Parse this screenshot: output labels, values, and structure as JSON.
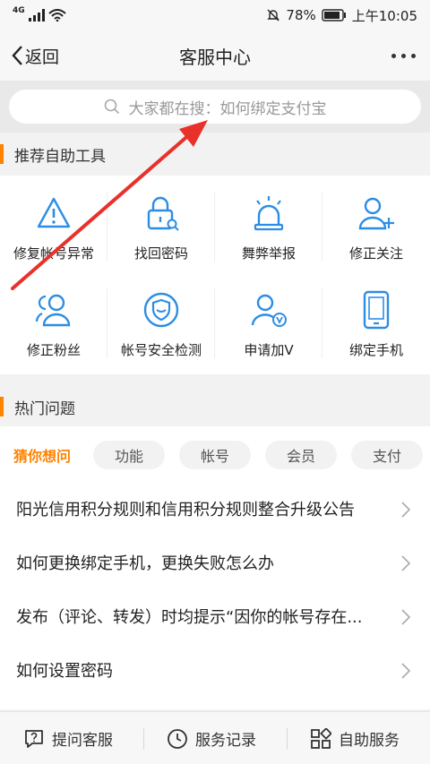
{
  "status_bar": {
    "network": "4G",
    "battery": "78%",
    "time": "上午10:05"
  },
  "nav": {
    "back_label": "返回",
    "title": "客服中心"
  },
  "search": {
    "placeholder": "大家都在搜：如何绑定支付宝"
  },
  "tools_section": {
    "title": "推荐自助工具",
    "items": [
      {
        "label": "修复帐号异常",
        "icon": "warning-icon"
      },
      {
        "label": "找回密码",
        "icon": "lock-search-icon"
      },
      {
        "label": "舞弊举报",
        "icon": "alarm-light-icon"
      },
      {
        "label": "修正关注",
        "icon": "user-add-icon"
      },
      {
        "label": "修正粉丝",
        "icon": "users-icon"
      },
      {
        "label": "帐号安全检测",
        "icon": "shield-icon"
      },
      {
        "label": "申请加V",
        "icon": "user-verified-icon"
      },
      {
        "label": "绑定手机",
        "icon": "phone-icon"
      }
    ]
  },
  "faq_section": {
    "title": "热门问题",
    "tabs": [
      "猜你想问",
      "功能",
      "帐号",
      "会员",
      "支付"
    ],
    "questions": [
      "阳光信用积分规则和信用积分规则整合升级公告",
      "如何更换绑定手机，更换失败怎么办",
      "发布（评论、转发）时均提示“因你的帐号存在异常”",
      "如何设置密码"
    ]
  },
  "bottom_bar": {
    "ask": "提问客服",
    "records": "服务记录",
    "self_service": "自助服务"
  },
  "colors": {
    "accent": "#ff8200",
    "icon_blue": "#2d8de4",
    "annotation_arrow": "#e8312a"
  }
}
